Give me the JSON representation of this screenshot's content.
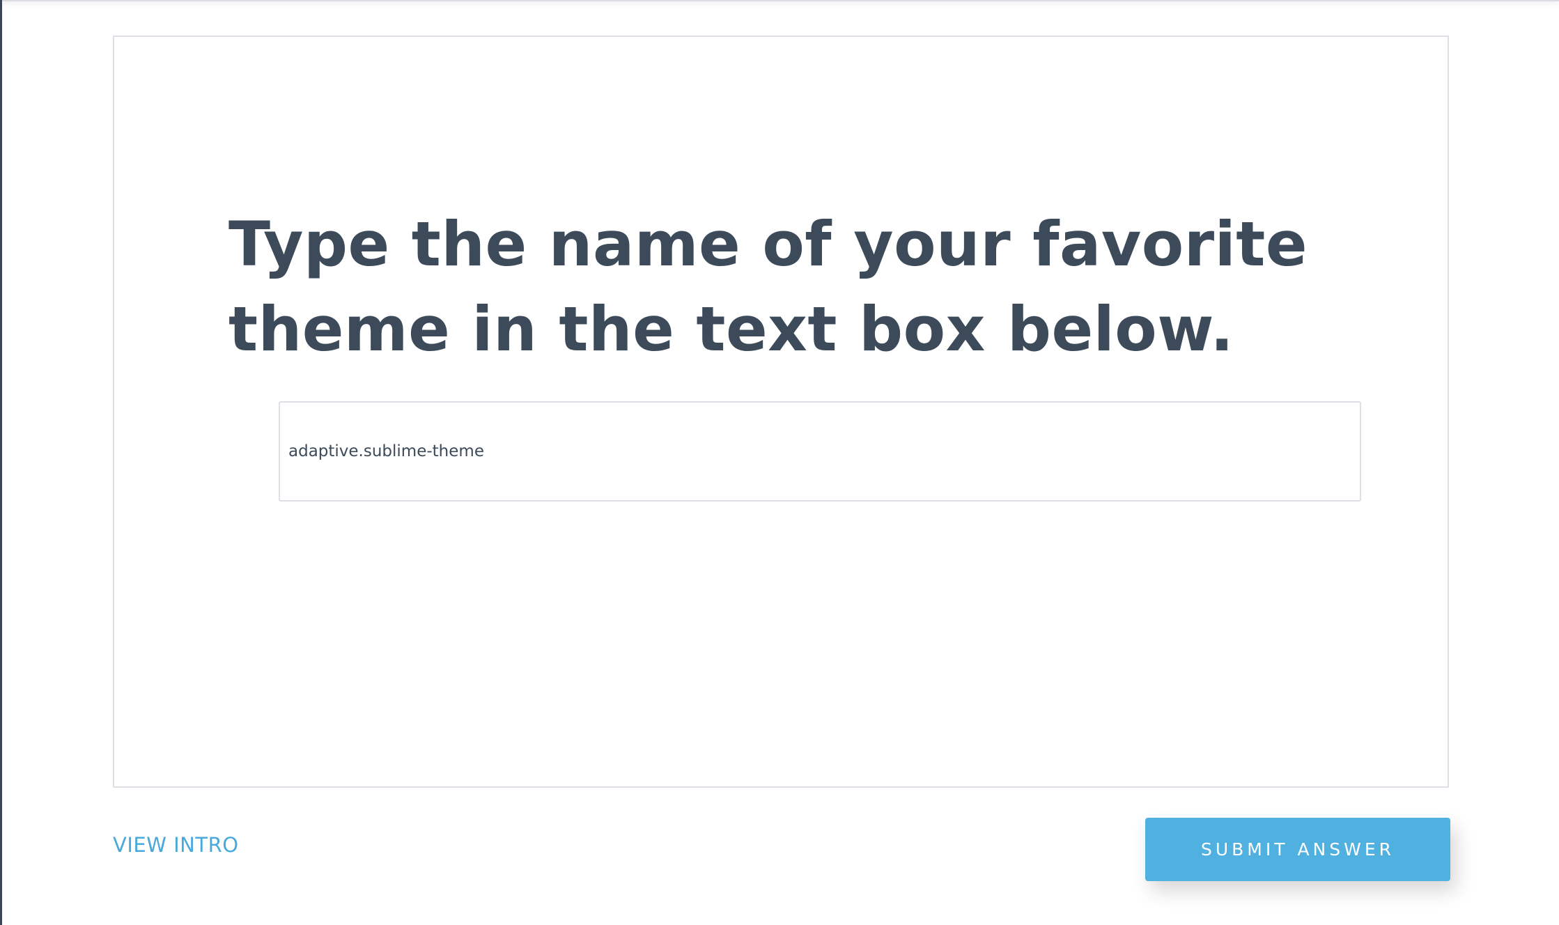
{
  "question": {
    "title": "Type the name of your favorite theme in the text box below."
  },
  "answer_field": {
    "value": "adaptive.sublime-theme",
    "placeholder": ""
  },
  "footer": {
    "view_intro_label": "VIEW INTRO",
    "submit_label": "SUBMIT ANSWER"
  },
  "colors": {
    "text": "#3c4a5a",
    "accent": "#50b1e1",
    "link": "#4aa9db",
    "border": "#dcdfe3"
  }
}
